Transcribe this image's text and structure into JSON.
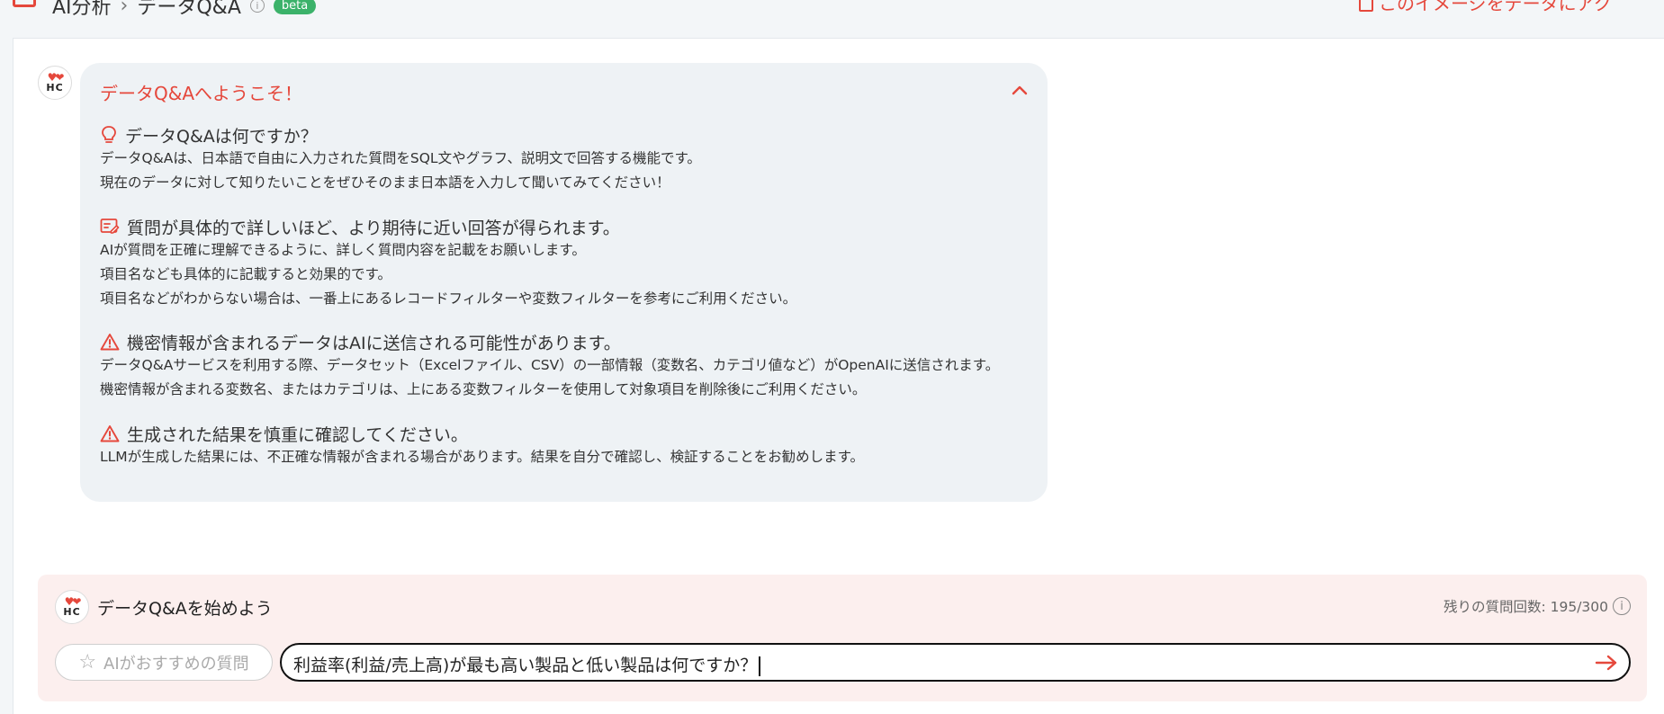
{
  "header": {
    "breadcrumb_root": "AI分析",
    "breadcrumb_sep": "›",
    "breadcrumb_current": "データQ&A",
    "info_glyph": "i",
    "badge": "beta",
    "right_link": "このイメージをデータにアク"
  },
  "welcome": {
    "title": "データQ&Aへようこそ！",
    "sections": [
      {
        "icon": "lightbulb-icon",
        "heading": "データQ&Aは何ですか？",
        "lines": [
          "データQ&Aは、日本語で自由に入力された質問をSQL文やグラフ、説明文で回答する機能です。",
          "現在のデータに対して知りたいことをぜひそのまま日本語を入力して聞いてみてください！"
        ]
      },
      {
        "icon": "edit-note-icon",
        "heading": "質問が具体的で詳しいほど、より期待に近い回答が得られます。",
        "lines": [
          "AIが質問を正確に理解できるように、詳しく質問内容を記載をお願いします。",
          "項目名なども具体的に記載すると効果的です。",
          "項目名などがわからない場合は、一番上にあるレコードフィルターや変数フィルターを参考にご利用ください。"
        ]
      },
      {
        "icon": "warning-icon",
        "heading": "機密情報が含まれるデータはAIに送信される可能性があります。",
        "lines": [
          "データQ&Aサービスを利用する際、データセット（Excelファイル、CSV）の一部情報（変数名、カテゴリ値など）がOpenAIに送信されます。",
          "機密情報が含まれる変数名、またはカテゴリは、上にある変数フィルターを使用して対象項目を削除後にご利用ください。"
        ]
      },
      {
        "icon": "warning-icon",
        "heading": "生成された結果を慎重に確認してください。",
        "lines": [
          "LLMが生成した結果には、不正確な情報が含まれる場合があります。結果を自分で確認し、検証することをお勧めします。"
        ]
      }
    ]
  },
  "logo": {
    "hearts": "♥❤",
    "letters": "HC"
  },
  "compose": {
    "title": "データQ&Aを始めよう",
    "remaining": "残りの質問回数: 195/300",
    "suggest_label": "AIがおすすめの質問",
    "star_glyph": "☆",
    "input_value": "利益率(利益/売上高)が最も高い製品と低い製品は何ですか？"
  },
  "colors": {
    "accent": "#e5483c",
    "welcome_bg": "#eef2f5",
    "compose_bg": "#fcefee",
    "beta": "#3bb26a"
  }
}
